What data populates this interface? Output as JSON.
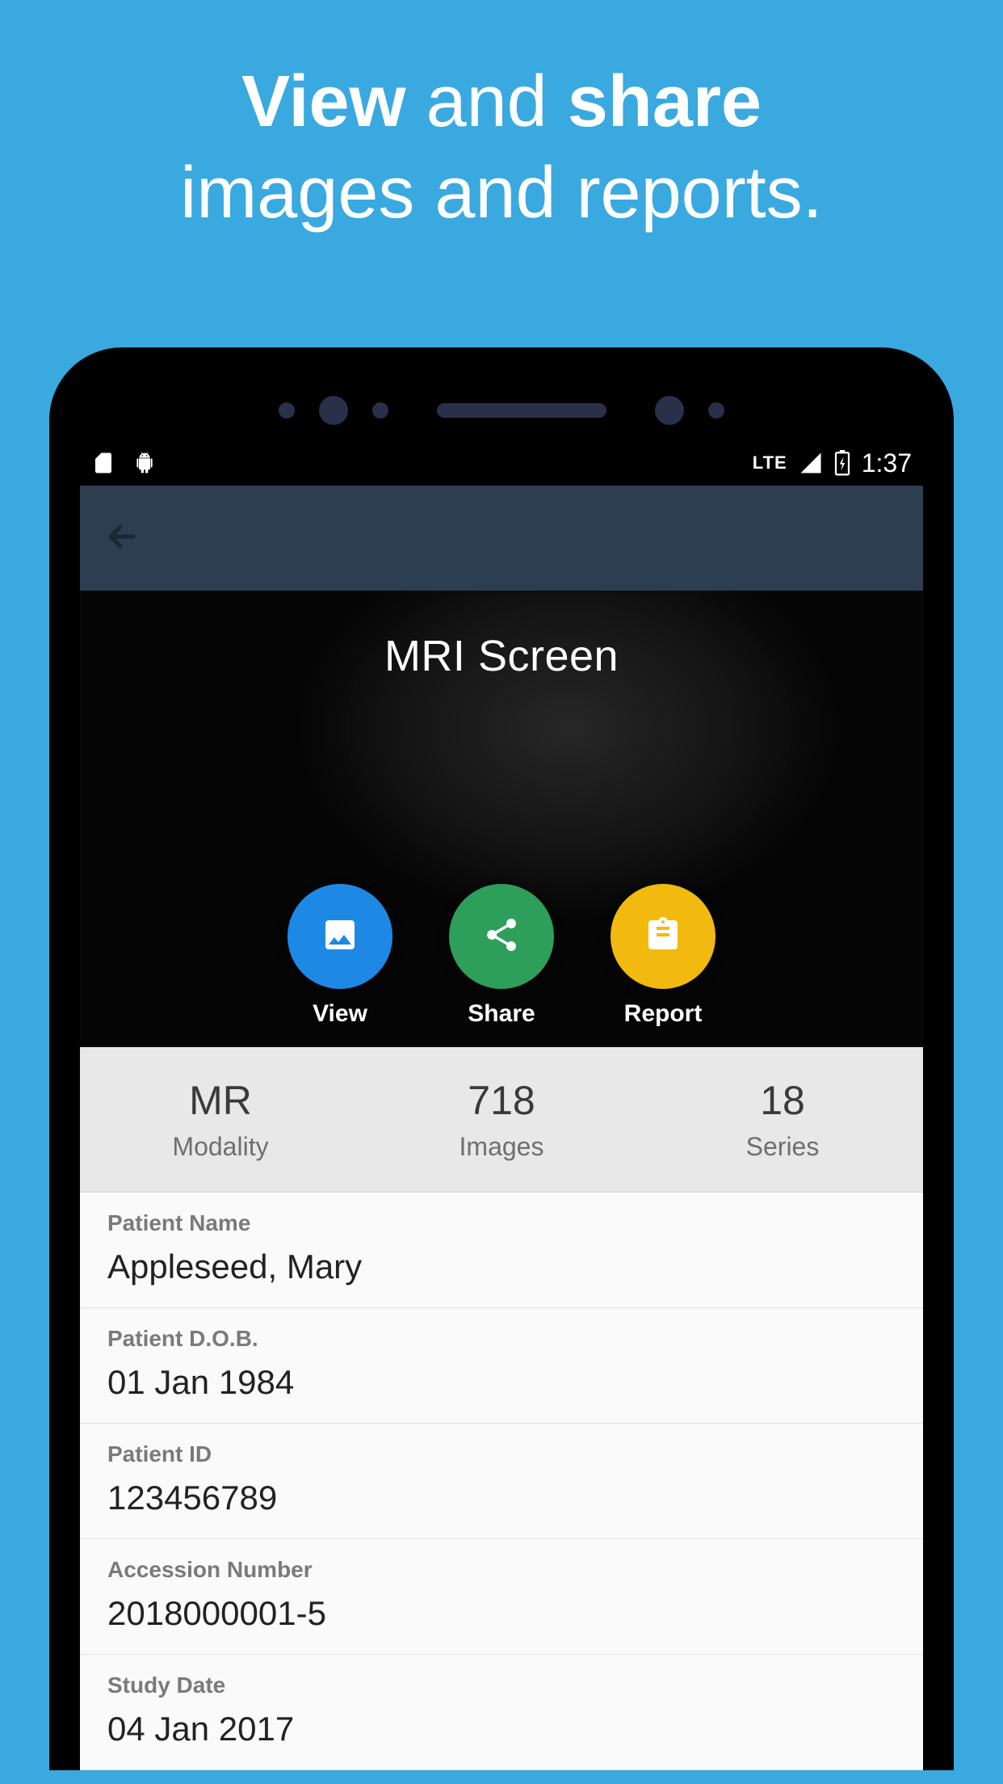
{
  "headline": {
    "w1": "View",
    "w2": "and",
    "w3": "share",
    "w4": "images and reports."
  },
  "statusbar": {
    "network": "LTE",
    "time": "1:37"
  },
  "hero": {
    "title": "MRI Screen",
    "actions": {
      "view": "View",
      "share": "Share",
      "report": "Report"
    }
  },
  "stats": [
    {
      "value": "MR",
      "label": "Modality"
    },
    {
      "value": "718",
      "label": "Images"
    },
    {
      "value": "18",
      "label": "Series"
    }
  ],
  "details": [
    {
      "label": "Patient Name",
      "value": "Appleseed, Mary"
    },
    {
      "label": "Patient D.O.B.",
      "value": "01 Jan 1984"
    },
    {
      "label": "Patient ID",
      "value": "123456789"
    },
    {
      "label": "Accession Number",
      "value": "2018000001-5"
    },
    {
      "label": "Study Date",
      "value": "04 Jan 2017"
    }
  ]
}
